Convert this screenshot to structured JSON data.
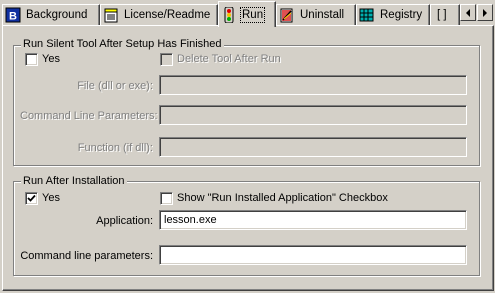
{
  "tabs": [
    {
      "label": "Background",
      "icon": "b-letter-icon",
      "active": false
    },
    {
      "label": "License/Readme",
      "icon": "notepad-icon",
      "active": false
    },
    {
      "label": "Run",
      "icon": "traffic-light-icon",
      "active": true
    },
    {
      "label": "Uninstall",
      "icon": "uninstall-book-icon",
      "active": false
    },
    {
      "label": "Registry",
      "icon": "registry-cube-icon",
      "active": false
    },
    {
      "label": "[ ]",
      "icon": "",
      "active": false
    }
  ],
  "silent_tool": {
    "legend": "Run Silent Tool After Setup Has Finished",
    "yes_label": "Yes",
    "yes_checked": false,
    "delete_tool_label": "Delete Tool After Run",
    "delete_tool_checked": false,
    "file_label": "File (dll or exe):",
    "file_value": "",
    "command_line_label": "Command Line Parameters:",
    "command_line_value": "",
    "function_label": "Function (if dll):",
    "function_value": ""
  },
  "run_after": {
    "legend": "Run After Installation",
    "yes_label": "Yes",
    "yes_checked": true,
    "show_checkbox_label": "Show \"Run Installed Application\" Checkbox",
    "show_checkbox_checked": false,
    "application_label": "Application:",
    "application_value": "lesson.exe",
    "params_label": "Command line parameters:",
    "params_value": ""
  }
}
